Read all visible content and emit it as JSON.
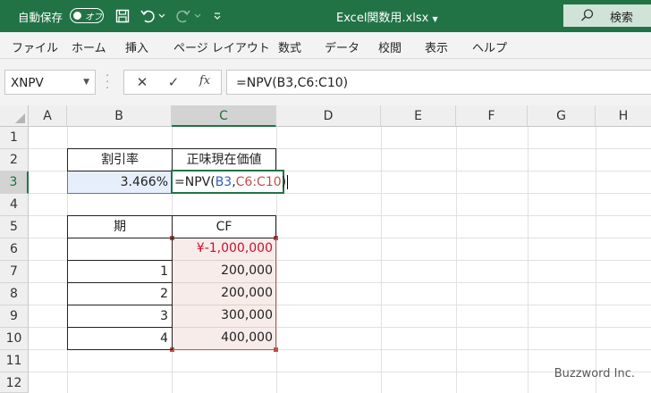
{
  "titlebar": {
    "autosave_label": "自動保存",
    "autosave_state": "オフ",
    "document_title": "Excel関数用.xlsx",
    "search_label": "検索"
  },
  "ribbon": {
    "tabs": [
      "ファイル",
      "ホーム",
      "挿入",
      "ページ レイアウト",
      "数式",
      "データ",
      "校閲",
      "表示",
      "ヘルプ"
    ]
  },
  "formula_bar": {
    "name_box": "XNPV",
    "fx": "fx",
    "formula": "=NPV(B3,C6:C10)"
  },
  "grid": {
    "columns": [
      "A",
      "B",
      "C",
      "D",
      "E",
      "F",
      "G",
      "H"
    ],
    "rows": [
      "1",
      "2",
      "3",
      "4",
      "5",
      "6",
      "7",
      "8",
      "9",
      "10",
      "11",
      "12"
    ],
    "selected_column": "C",
    "selected_row": "3"
  },
  "cells": {
    "B2": "割引率",
    "C2": "正味現在価値",
    "B3": "3.466%",
    "C3_parts": [
      "=NPV(",
      "B3",
      ",",
      "C6:C10",
      ")"
    ],
    "B5": "期",
    "C5": "CF",
    "B7": "1",
    "B8": "2",
    "B9": "3",
    "B10": "4",
    "C6": "¥-1,000,000",
    "C7": "200,000",
    "C8": "200,000",
    "C9": "300,000",
    "C10": "400,000"
  },
  "watermark": "Buzzword Inc.",
  "colors": {
    "excel_green": "#217346",
    "ref_blue": "#4a7bd0",
    "ref_red": "#c0504d",
    "negative_red": "#c8102e"
  }
}
